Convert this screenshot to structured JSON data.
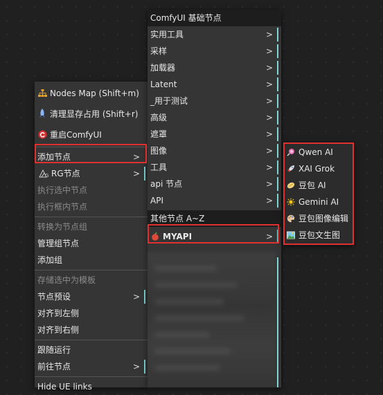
{
  "left_menu": {
    "items": [
      {
        "label": "Nodes Map (Shift+m)",
        "icon": "sitemap-icon"
      },
      {
        "label": "清理显存占用 (Shift+r)",
        "icon": "rocket-icon"
      },
      {
        "label": "重启ComfyUI",
        "icon": "restart-icon"
      },
      {
        "label": "添加节点"
      },
      {
        "label": "RG节点",
        "icon": "rg-icon"
      },
      {
        "label": "执行选中节点"
      },
      {
        "label": "执行框内节点"
      },
      {
        "label": "转换为节点组"
      },
      {
        "label": "管理组节点"
      },
      {
        "label": "添加组"
      },
      {
        "label": "存储选中为模板"
      },
      {
        "label": "节点预设"
      },
      {
        "label": "对齐到左侧"
      },
      {
        "label": "对齐到右侧"
      },
      {
        "label": "跟随运行"
      },
      {
        "label": "前往节点"
      },
      {
        "label": "Hide UE links"
      }
    ],
    "arrow": ">"
  },
  "mid_menu": {
    "header_basic": "ComfyUI 基础节点",
    "basic_items": [
      "实用工具",
      "采样",
      "加载器",
      "Latent",
      "_用于测试",
      "高级",
      "遮罩",
      "图像",
      "工具",
      "api 节点",
      "API"
    ],
    "header_other": "其他节点 A~Z",
    "other_items": [
      "MYAPI"
    ],
    "arrow": ">"
  },
  "right_menu": {
    "items": [
      {
        "label": "Qwen AI",
        "icon": "lollipop-icon"
      },
      {
        "label": "XAI Grok",
        "icon": "rocket-icon"
      },
      {
        "label": "豆包 AI",
        "icon": "bean-icon"
      },
      {
        "label": "Gemini AI",
        "icon": "sparkle-icon"
      },
      {
        "label": "豆包图像编辑",
        "icon": "palette-icon"
      },
      {
        "label": "豆包文生图",
        "icon": "picture-icon"
      }
    ]
  },
  "colors": {
    "highlight_border": "#e03030",
    "accent_tick": "#7fd6d6"
  }
}
